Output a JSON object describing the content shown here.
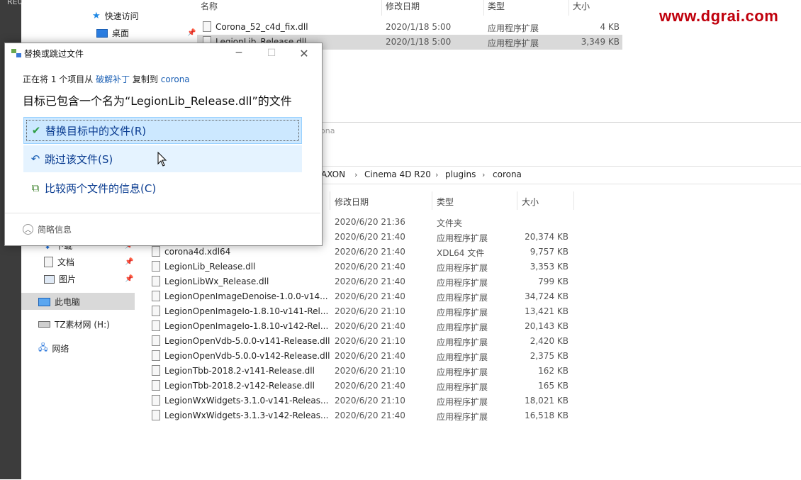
{
  "desktop": {
    "top_text": "RE0"
  },
  "watermark": "www.dgrai.com",
  "back_explorer": {
    "nav": [
      {
        "label": "快速访问",
        "icon": "star-icon"
      },
      {
        "label": "桌面",
        "icon": "desktop-icon"
      }
    ],
    "columns": [
      "名称",
      "修改日期",
      "类型",
      "大小"
    ],
    "rows": [
      {
        "name": "Corona_52_c4d_fix.dll",
        "date": "2020/1/18 5:00",
        "type": "应用程序扩展",
        "size": "4 KB"
      },
      {
        "name": "LegionLib_Release.dll",
        "date": "2020/1/18 5:00",
        "type": "应用程序扩展",
        "size": "3,349 KB"
      }
    ]
  },
  "front_explorer": {
    "title_fragment": "ona",
    "breadcrumb": [
      "AXON",
      "Cinema 4D R20",
      "plugins",
      "corona"
    ],
    "columns": [
      "修改日期",
      "类型",
      "大小"
    ],
    "left_nav": [
      {
        "label": "下载",
        "icon": "download-icon"
      },
      {
        "label": "文档",
        "icon": "document-icon"
      },
      {
        "label": "图片",
        "icon": "picture-icon"
      },
      {
        "label": "此电脑",
        "icon": "computer-icon"
      },
      {
        "label": "TZ素材网 (H:)",
        "icon": "drive-icon"
      },
      {
        "label": "网络",
        "icon": "network-icon"
      }
    ],
    "rows": [
      {
        "name": "",
        "date": "2020/6/20 21:36",
        "type": "文件夹",
        "size": ""
      },
      {
        "name": "",
        "date": "2020/6/20 21:40",
        "type": "应用程序扩展",
        "size": "20,374 KB"
      },
      {
        "name": "corona4d.xdl64",
        "date": "2020/6/20 21:40",
        "type": "XDL64 文件",
        "size": "9,757 KB"
      },
      {
        "name": "LegionLib_Release.dll",
        "date": "2020/6/20 21:40",
        "type": "应用程序扩展",
        "size": "3,353 KB"
      },
      {
        "name": "LegionLibWx_Release.dll",
        "date": "2020/6/20 21:40",
        "type": "应用程序扩展",
        "size": "799 KB"
      },
      {
        "name": "LegionOpenImageDenoise-1.0.0-v14...",
        "date": "2020/6/20 21:40",
        "type": "应用程序扩展",
        "size": "34,724 KB"
      },
      {
        "name": "LegionOpenImageIo-1.8.10-v141-Rel...",
        "date": "2020/6/20 21:10",
        "type": "应用程序扩展",
        "size": "13,421 KB"
      },
      {
        "name": "LegionOpenImageIo-1.8.10-v142-Rel...",
        "date": "2020/6/20 21:40",
        "type": "应用程序扩展",
        "size": "20,143 KB"
      },
      {
        "name": "LegionOpenVdb-5.0.0-v141-Release.dll",
        "date": "2020/6/20 21:10",
        "type": "应用程序扩展",
        "size": "2,420 KB"
      },
      {
        "name": "LegionOpenVdb-5.0.0-v142-Release.dll",
        "date": "2020/6/20 21:40",
        "type": "应用程序扩展",
        "size": "2,375 KB"
      },
      {
        "name": "LegionTbb-2018.2-v141-Release.dll",
        "date": "2020/6/20 21:10",
        "type": "应用程序扩展",
        "size": "162 KB"
      },
      {
        "name": "LegionTbb-2018.2-v142-Release.dll",
        "date": "2020/6/20 21:40",
        "type": "应用程序扩展",
        "size": "165 KB"
      },
      {
        "name": "LegionWxWidgets-3.1.0-v141-Releas...",
        "date": "2020/6/20 21:10",
        "type": "应用程序扩展",
        "size": "18,021 KB"
      },
      {
        "name": "LegionWxWidgets-3.1.3-v142-Releas...",
        "date": "2020/6/20 21:40",
        "type": "应用程序扩展",
        "size": "16,518 KB"
      }
    ]
  },
  "dialog": {
    "title": "替换或跳过文件",
    "line1_prefix": "正在将 1 个项目从 ",
    "line1_source": "破解补丁",
    "line1_middle": " 复制到 ",
    "line1_dest": "corona",
    "line2": "目标已包含一个名为“LegionLib_Release.dll”的文件",
    "options": [
      {
        "label": "替换目标中的文件(R)",
        "icon": "checkmark-icon"
      },
      {
        "label": "跳过该文件(S)",
        "icon": "skip-icon"
      },
      {
        "label": "比较两个文件的信息(C)",
        "icon": "compare-icon"
      }
    ],
    "more_label": "简略信息"
  },
  "colors": {
    "accent": "#0b3d91",
    "selection": "#cce8ff",
    "hover": "#e5f3ff",
    "watermark": "#c0000c"
  }
}
